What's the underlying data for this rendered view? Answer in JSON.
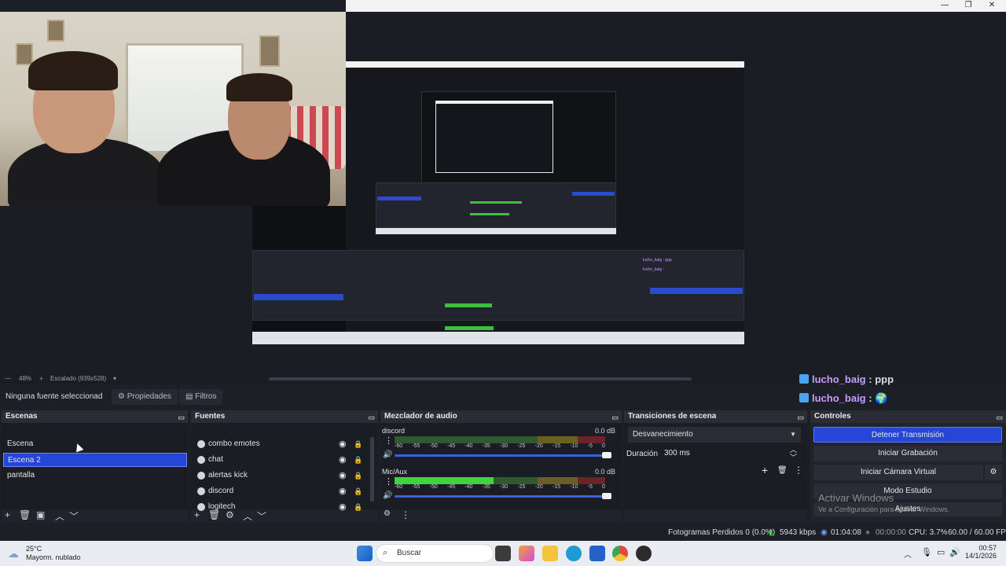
{
  "colors": {
    "accent": "#2546d6",
    "meter_green": "#3fd43f",
    "chat_user": "#c99cff"
  },
  "window": {
    "minimize_icon": "minimize-icon",
    "maximize_icon": "restore-icon",
    "close_icon": "close-icon"
  },
  "preview": {
    "zoom": "48%",
    "scale_label": "Escalado (939x528)"
  },
  "source_toolbar": {
    "no_selection": "Ninguna fuente seleccionad",
    "properties": "Propiedades",
    "filters": "Filtros"
  },
  "chat": [
    {
      "user": "lucho_baig",
      "sep": " : ",
      "message": "ppp"
    },
    {
      "user": "lucho_baig",
      "sep": " : ",
      "message": "🌍"
    }
  ],
  "scenes": {
    "title": "Escenas",
    "items": [
      "Escena",
      "Escena 2",
      "pantalla"
    ],
    "selected": "Escena 2"
  },
  "sources": {
    "title": "Fuentes",
    "items": [
      "combo emotes",
      "chat",
      "alertas kick",
      "discord",
      "logitech"
    ]
  },
  "mixer": {
    "title": "Mezclador de audio",
    "scale": [
      "-60",
      "-55",
      "-50",
      "-45",
      "-40",
      "-35",
      "-30",
      "-25",
      "-20",
      "-15",
      "-10",
      "-5",
      "0"
    ],
    "channels": [
      {
        "name": "discord",
        "db": "0.0 dB",
        "level": 0.0
      },
      {
        "name": "Mic/Aux",
        "db": "0.0 dB",
        "level": 0.47
      }
    ]
  },
  "transitions": {
    "title": "Transiciones de escena",
    "selected": "Desvanecimiento",
    "duration_label": "Duración",
    "duration_value": "300 ms"
  },
  "controls": {
    "title": "Controles",
    "stop_stream": "Detener Transmisión",
    "start_recording": "Iniciar Grabación",
    "start_virtual_cam": "Iniciar Cámara Virtual",
    "studio_mode": "Modo Estudio",
    "settings": "Ajustes",
    "activate_title": "Activar Windows",
    "activate_sub": "Ve a Configuración para activar Windows."
  },
  "statusbar": {
    "dropped": "Fotogramas Perdidos 0 (0.0%)",
    "bitrate": "5943 kbps",
    "stream_time": "01:04:08",
    "rec_time": "00:00:00",
    "cpu": "CPU: 3.7%",
    "fps": "60.00 / 60.00 FPS"
  },
  "taskbar": {
    "temp": "25°C",
    "weather": "Mayorm. nublado",
    "search": "Buscar",
    "time": "00:57",
    "date": "14/1/2026"
  }
}
